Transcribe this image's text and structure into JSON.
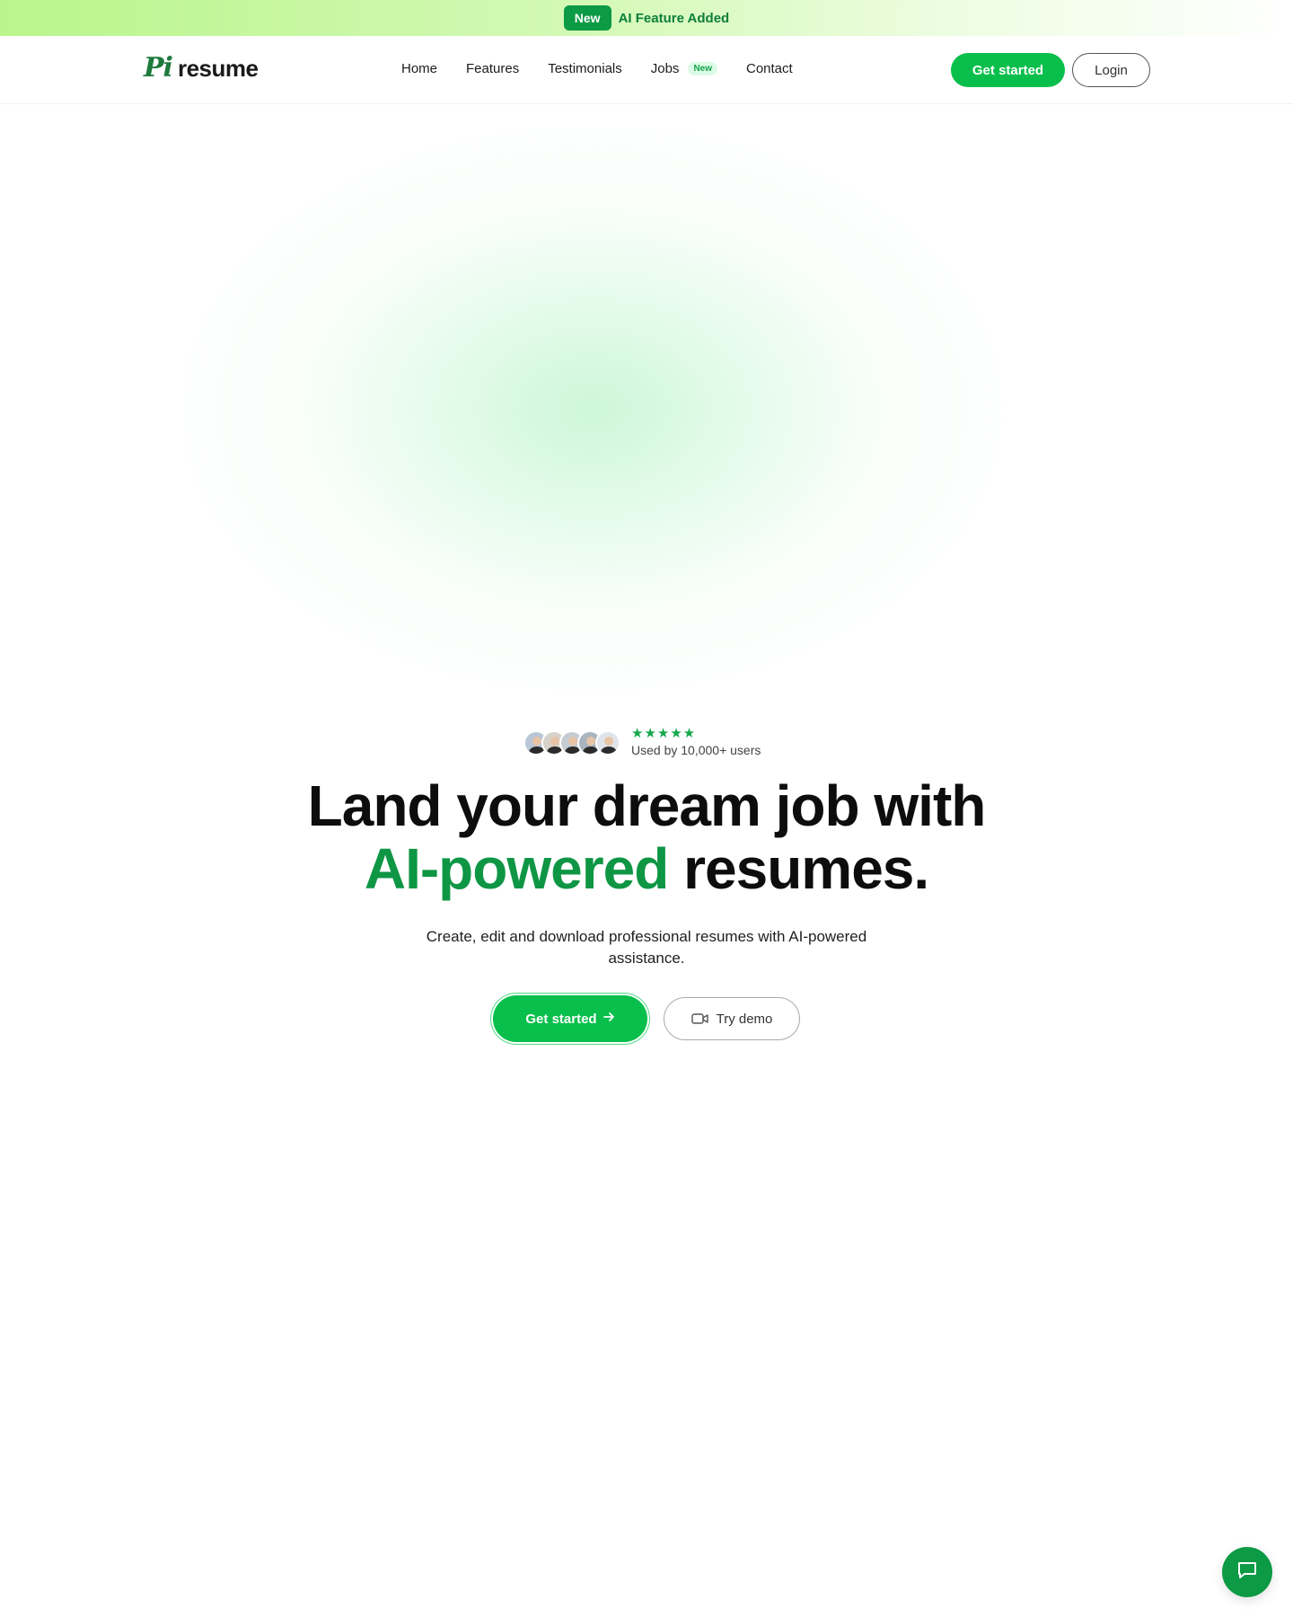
{
  "announcement": {
    "badge": "New",
    "text": "AI Feature Added"
  },
  "header": {
    "logo_mark": "Pi",
    "logo_word": "resume",
    "nav": [
      {
        "label": "Home"
      },
      {
        "label": "Features"
      },
      {
        "label": "Testimonials"
      },
      {
        "label": "Jobs",
        "badge": "New"
      },
      {
        "label": "Contact"
      }
    ],
    "get_started_label": "Get started",
    "login_label": "Login"
  },
  "proof": {
    "stars": "★★★★★",
    "rating": 5,
    "text": "Used by 10,000+ users"
  },
  "hero": {
    "title_line1": "Land your dream job with",
    "title_accent": "AI-powered",
    "title_line2_rest": " resumes.",
    "subtitle": "Create, edit and download professional resumes with AI-powered assistance.",
    "cta_primary": "Get started",
    "cta_secondary": "Try demo"
  },
  "colors": {
    "brand_green": "#08bf4b",
    "accent_dark_green": "#0e9644",
    "announce_gradient_start": "#b9f58c"
  },
  "icons": {
    "cta_arrow": "arrow-right-icon",
    "demo": "video-camera-icon",
    "chat": "chat-bubble-icon"
  }
}
